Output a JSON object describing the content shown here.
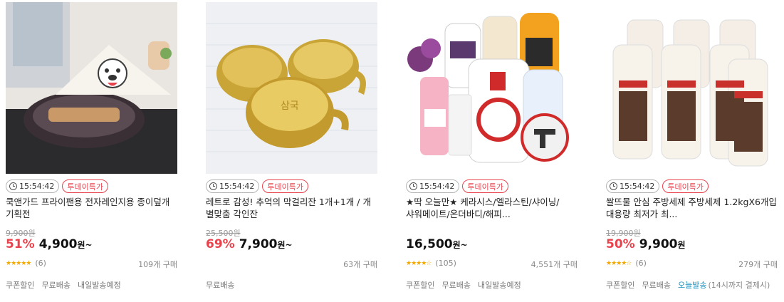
{
  "products": [
    {
      "timer": "15:54:42",
      "deal_badge": "투데이특가",
      "title_line1": "쿡앤가드 프라이팬용 전자레인지용 종이덮개",
      "title_line2": "기획전",
      "original_price": "9,900원",
      "discount_rate": "51%",
      "price": "4,900",
      "price_unit": "원~",
      "rating": 5,
      "review_count": "(6)",
      "sold_count": "109개 구매",
      "shipping": [
        "쿠폰할인",
        "무료배송",
        "내일발송예정"
      ]
    },
    {
      "timer": "15:54:42",
      "deal_badge": "투데이특가",
      "title_line1": "레트로 감성! 추억의 막걸리잔 1개+1개 / 개",
      "title_line2": "별맞춤 각인잔",
      "original_price": "25,500원",
      "discount_rate": "69%",
      "price": "7,900",
      "price_unit": "원~",
      "sold_count": "63개 구매",
      "shipping": [
        "무료배송"
      ]
    },
    {
      "timer": "15:54:42",
      "deal_badge": "투데이특가",
      "title_line1": "★딱 오늘만★ 케라시스/엘라스틴/샤이닝/",
      "title_line2": "샤워메이트/온더바디/해피...",
      "price": "16,500",
      "price_unit": "원~",
      "rating": 4.5,
      "review_count": "(105)",
      "sold_count": "4,551개 구매",
      "shipping": [
        "쿠폰할인",
        "무료배송",
        "내일발송예정"
      ]
    },
    {
      "timer": "15:54:42",
      "deal_badge": "투데이특가",
      "title_line1": "쌀뜨물 안심 주방세제 주방세제 1.2kgX6개입",
      "title_line2": "대용량 최저가 최...",
      "original_price": "19,900원",
      "discount_rate": "50%",
      "price": "9,900",
      "price_unit": "원",
      "rating": 4.5,
      "review_count": "(6)",
      "sold_count": "279개 구매",
      "shipping": [
        "쿠폰할인",
        "무료배송",
        "오늘발송"
      ],
      "shipping_note": "(14시까지 결제시)"
    }
  ],
  "colors": {
    "accent": "#e8434d",
    "star": "#f2a900",
    "today_ship": "#1a8fbf"
  }
}
